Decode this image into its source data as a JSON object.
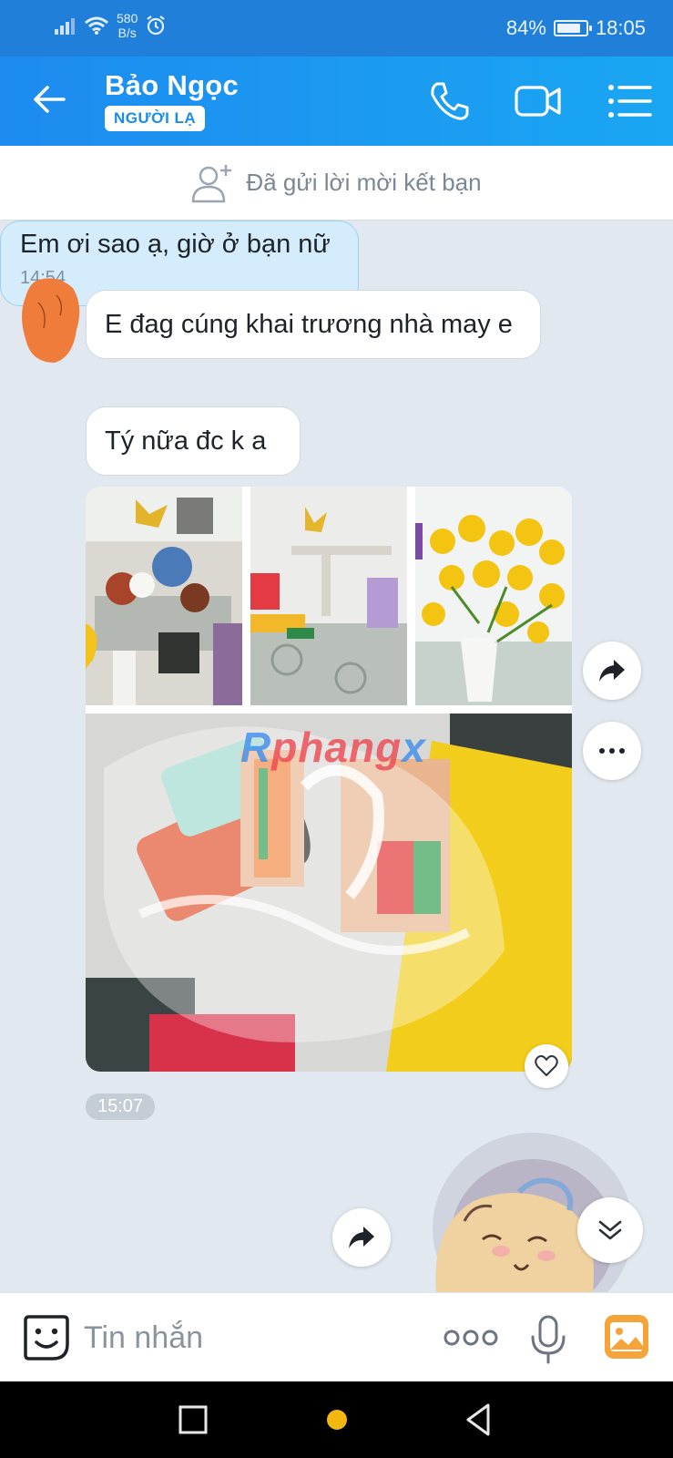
{
  "status_bar": {
    "net_speed_value": "580",
    "net_speed_unit": "B/s",
    "battery": "84%",
    "battery_level": 0.84,
    "time": "18:05"
  },
  "header": {
    "contact_name": "Bảo Ngọc",
    "badge": "NGƯỜI LẠ"
  },
  "friend_request": {
    "text": "Đã gửi lời mời kết bạn"
  },
  "chat": {
    "outgoing": {
      "text": "Em ơi sao ạ, giờ ở bạn nữ",
      "time": "14:54"
    },
    "incoming": [
      {
        "text": "E đag cúng khai trương nhà may e"
      },
      {
        "text": "Tý nữa đc k a"
      }
    ],
    "photo_group_time": "15:07",
    "watermark": {
      "part1": "R",
      "part2": "phang",
      "part3": "x"
    }
  },
  "input": {
    "placeholder": "Tin nhắn"
  },
  "colors": {
    "header": "#1d8bf0",
    "accent": "#1a8de8",
    "bubble_out": "#d5ecfc"
  }
}
